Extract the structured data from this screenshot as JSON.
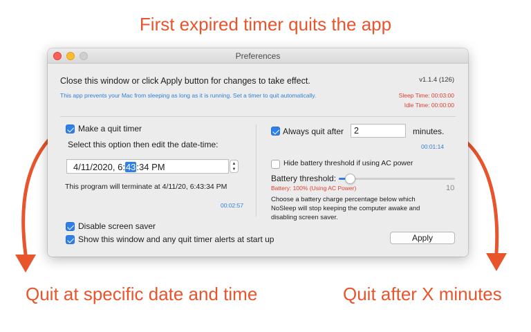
{
  "captions": {
    "top": "First expired timer quits the app",
    "left": "Quit at specific date and time",
    "right": "Quit after X minutes"
  },
  "window": {
    "title": "Preferences",
    "instruction": "Close this window or click Apply button for changes to take effect.",
    "version": "v1.1.4 (126)",
    "description": "This app prevents your Mac from sleeping as long as it is running. Set a timer to quit automatically.",
    "sleep_time": "Sleep Time: 00:03:00",
    "idle_time": "Idle Time: 00:00:00"
  },
  "left_panel": {
    "quit_timer_label": "Make a quit timer",
    "quit_timer_checked": true,
    "select_hint": "Select this option then edit the date-time:",
    "datetime": {
      "before": "4/11/2020,  6:",
      "selected": "43",
      "after": ":34 PM"
    },
    "terminate_text": "This program will terminate at 4/11/20, 6:43:34 PM",
    "countdown": "00:02:57"
  },
  "right_panel": {
    "always_quit_label": "Always quit after",
    "always_quit_checked": true,
    "minutes_value": "2",
    "minutes_label": "minutes.",
    "countdown": "00:01:14",
    "hide_battery_label": "Hide battery threshold if using AC power",
    "hide_battery_checked": false,
    "battery_threshold_label": "Battery threshold:",
    "battery_status": "Battery: 100% (Using AC Power)",
    "battery_max_label": "10",
    "battery_value_fraction": 0.1,
    "battery_description": [
      "Choose a battery charge percentage below which",
      "NoSleep will stop keeping the computer awake and",
      "disabling screen saver."
    ]
  },
  "bottom": {
    "disable_screensaver_label": "Disable screen saver",
    "disable_screensaver_checked": true,
    "show_window_label": "Show this window and any quit timer alerts at start up",
    "show_window_checked": true,
    "apply_label": "Apply"
  },
  "colors": {
    "accent": "#2f7fe8",
    "caption": "#e8542c",
    "alert_red": "#e03d2f",
    "link_blue": "#2f7fd8"
  }
}
